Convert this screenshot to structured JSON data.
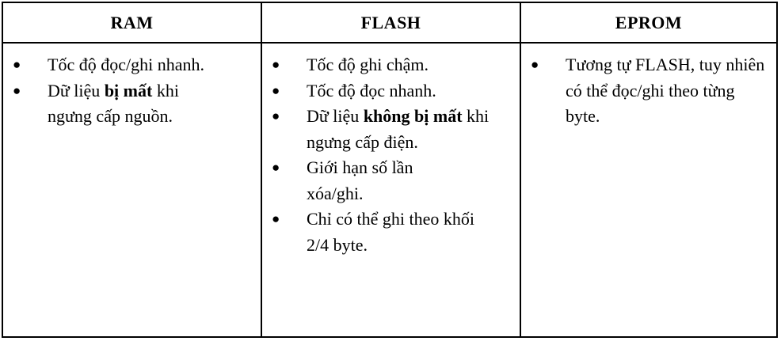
{
  "headers": [
    "RAM",
    "FLASH",
    "EPROM"
  ],
  "bullet_symbol": "●",
  "ram": {
    "items": [
      {
        "text": " Tốc độ đọc/ghi nhanh."
      },
      {
        "before": " Dữ liệu ",
        "bold": "bị mất",
        "after": " khi ngưng cấp nguồn."
      }
    ]
  },
  "flash": {
    "items": [
      {
        "text": " Tốc độ ghi chậm."
      },
      {
        "text": " Tốc độ đọc nhanh."
      },
      {
        "before": " Dữ liệu ",
        "bold": "không bị mất",
        "after": " khi ngưng cấp điện."
      },
      {
        "text": " Giới hạn số lần xóa/ghi."
      },
      {
        "text": " Chỉ có thể ghi theo khối 2/4 byte."
      }
    ]
  },
  "eprom": {
    "items": [
      {
        "text": " Tương tự FLASH, tuy nhiên có thể đọc/ghi theo từng byte."
      }
    ]
  }
}
